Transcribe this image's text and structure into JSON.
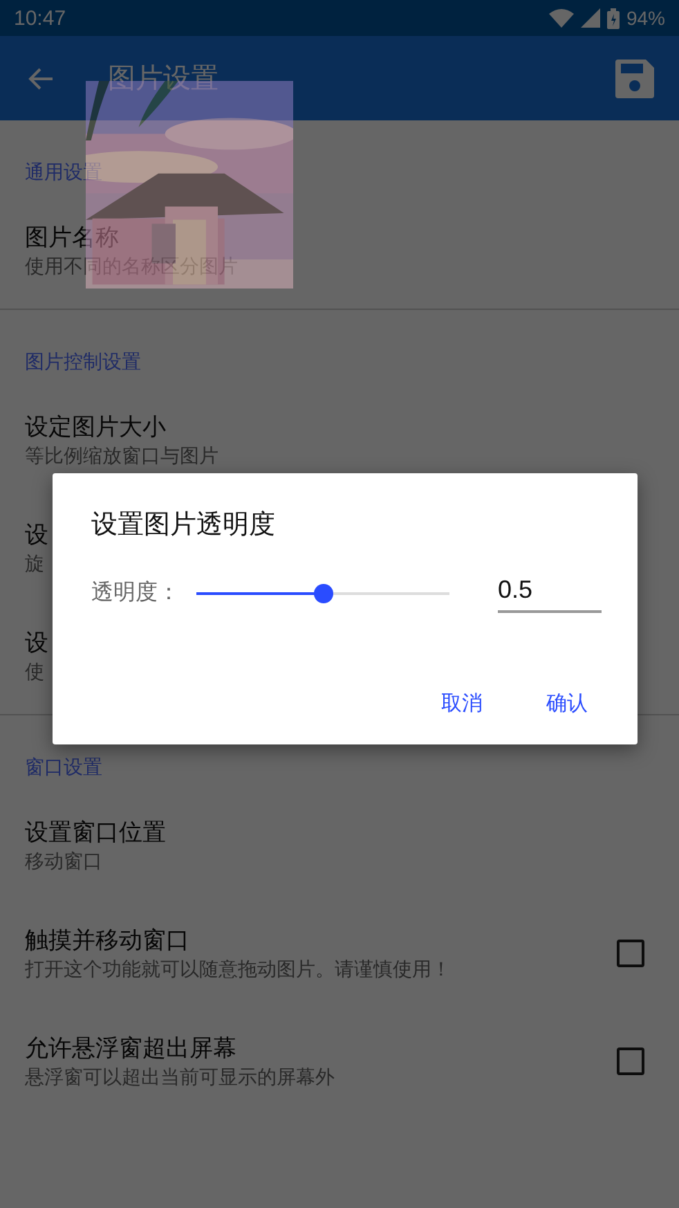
{
  "status_bar": {
    "time": "10:47",
    "battery": "94%"
  },
  "app_bar": {
    "title": "图片设置"
  },
  "sections": [
    {
      "header": "通用设置",
      "items": [
        {
          "kind": "plain",
          "title": "图片名称",
          "subtitle": "使用不同的名称区分图片"
        }
      ]
    },
    {
      "header": "图片控制设置",
      "items": [
        {
          "kind": "plain",
          "title": "设定图片大小",
          "subtitle": "等比例缩放窗口与图片"
        },
        {
          "kind": "plain",
          "title": "设",
          "subtitle": "旋"
        },
        {
          "kind": "plain",
          "title": "设",
          "subtitle": "使"
        }
      ]
    },
    {
      "header": "窗口设置",
      "items": [
        {
          "kind": "plain",
          "title": "设置窗口位置",
          "subtitle": "移动窗口"
        },
        {
          "kind": "checkbox",
          "title": "触摸并移动窗口",
          "subtitle": "打开这个功能就可以随意拖动图片。请谨慎使用！",
          "checked": false
        },
        {
          "kind": "checkbox",
          "title": "允许悬浮窗超出屏幕",
          "subtitle": "悬浮窗可以超出当前可显示的屏幕外",
          "checked": false
        }
      ]
    }
  ],
  "dialog": {
    "title": "设置图片透明度",
    "label": "透明度：",
    "slider": {
      "level": 0.5
    },
    "value": "0.5",
    "buttons": [
      "取消",
      "确认"
    ]
  }
}
